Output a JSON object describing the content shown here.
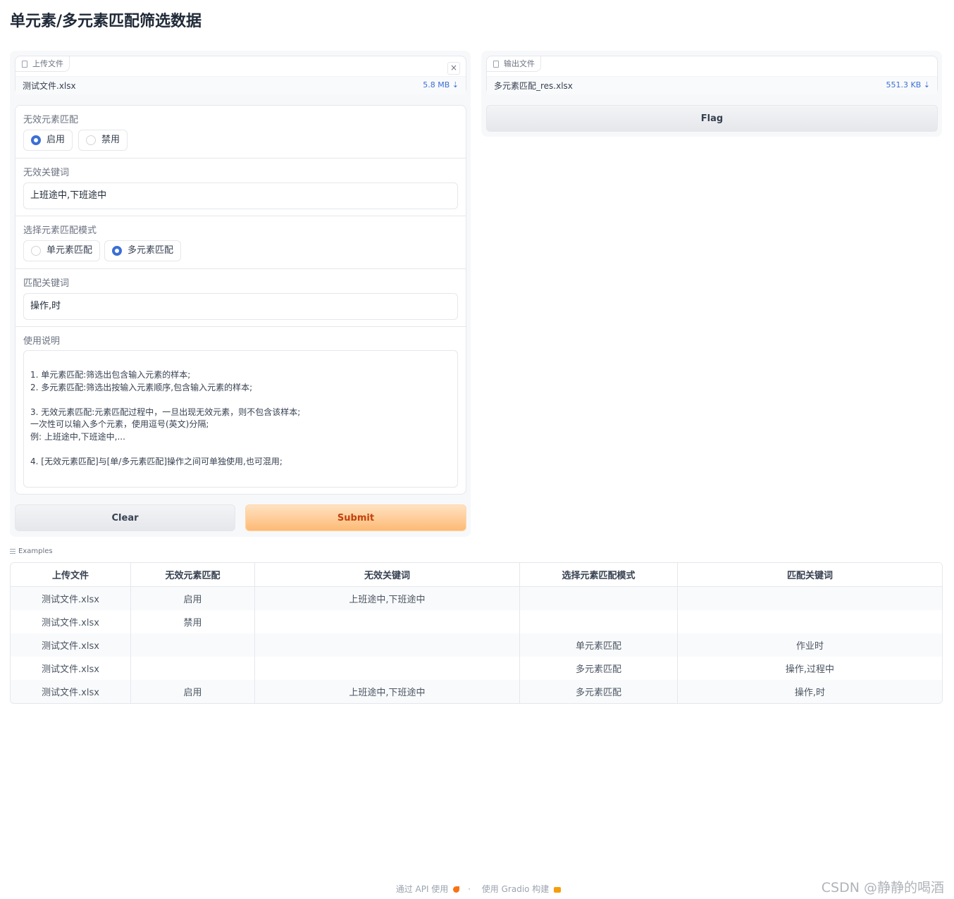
{
  "title": "单元素/多元素匹配筛选数据",
  "upload": {
    "label": "上传文件",
    "file_name": "测试文件.xlsx",
    "file_size": "5.8 MB ⇣",
    "close": "×"
  },
  "invalid_match": {
    "label": "无效元素匹配",
    "options": [
      "启用",
      "禁用"
    ],
    "selected": "启用"
  },
  "invalid_keywords": {
    "label": "无效关键词",
    "value": "上班途中,下班途中"
  },
  "match_mode": {
    "label": "选择元素匹配模式",
    "options": [
      "单元素匹配",
      "多元素匹配"
    ],
    "selected": "多元素匹配"
  },
  "match_keywords": {
    "label": "匹配关键词",
    "value": "操作,时"
  },
  "instructions": {
    "label": "使用说明",
    "lines": [
      "1. 单元素匹配:筛选出包含输入元素的样本;",
      "2. 多元素匹配:筛选出按输入元素顺序,包含输入元素的样本;",
      "",
      "3. 无效元素匹配:元素匹配过程中，一旦出现无效元素，则不包含该样本;",
      "一次性可以输入多个元素，使用逗号(英文)分隔;",
      "例: 上班途中,下班途中,...",
      "",
      "4. [无效元素匹配]与[单/多元素匹配]操作之间可单独使用,也可混用;"
    ]
  },
  "buttons": {
    "clear": "Clear",
    "submit": "Submit",
    "flag": "Flag"
  },
  "output": {
    "label": "输出文件",
    "file_name": "多元素匹配_res.xlsx",
    "file_size": "551.3 KB ⇣"
  },
  "examples": {
    "label": "Examples",
    "headers": [
      "上传文件",
      "无效元素匹配",
      "无效关键词",
      "选择元素匹配模式",
      "匹配关键词"
    ],
    "rows": [
      [
        "测试文件.xlsx",
        "启用",
        "上班途中,下班途中",
        "",
        ""
      ],
      [
        "测试文件.xlsx",
        "禁用",
        "",
        "",
        ""
      ],
      [
        "测试文件.xlsx",
        "",
        "",
        "单元素匹配",
        "作业时"
      ],
      [
        "测试文件.xlsx",
        "",
        "",
        "多元素匹配",
        "操作,过程中"
      ],
      [
        "测试文件.xlsx",
        "启用",
        "上班途中,下班途中",
        "多元素匹配",
        "操作,时"
      ]
    ]
  },
  "footer": {
    "api": "通过 API 使用",
    "sep": "·",
    "built": "使用 Gradio 构建"
  },
  "watermark": "CSDN @静静的喝酒"
}
